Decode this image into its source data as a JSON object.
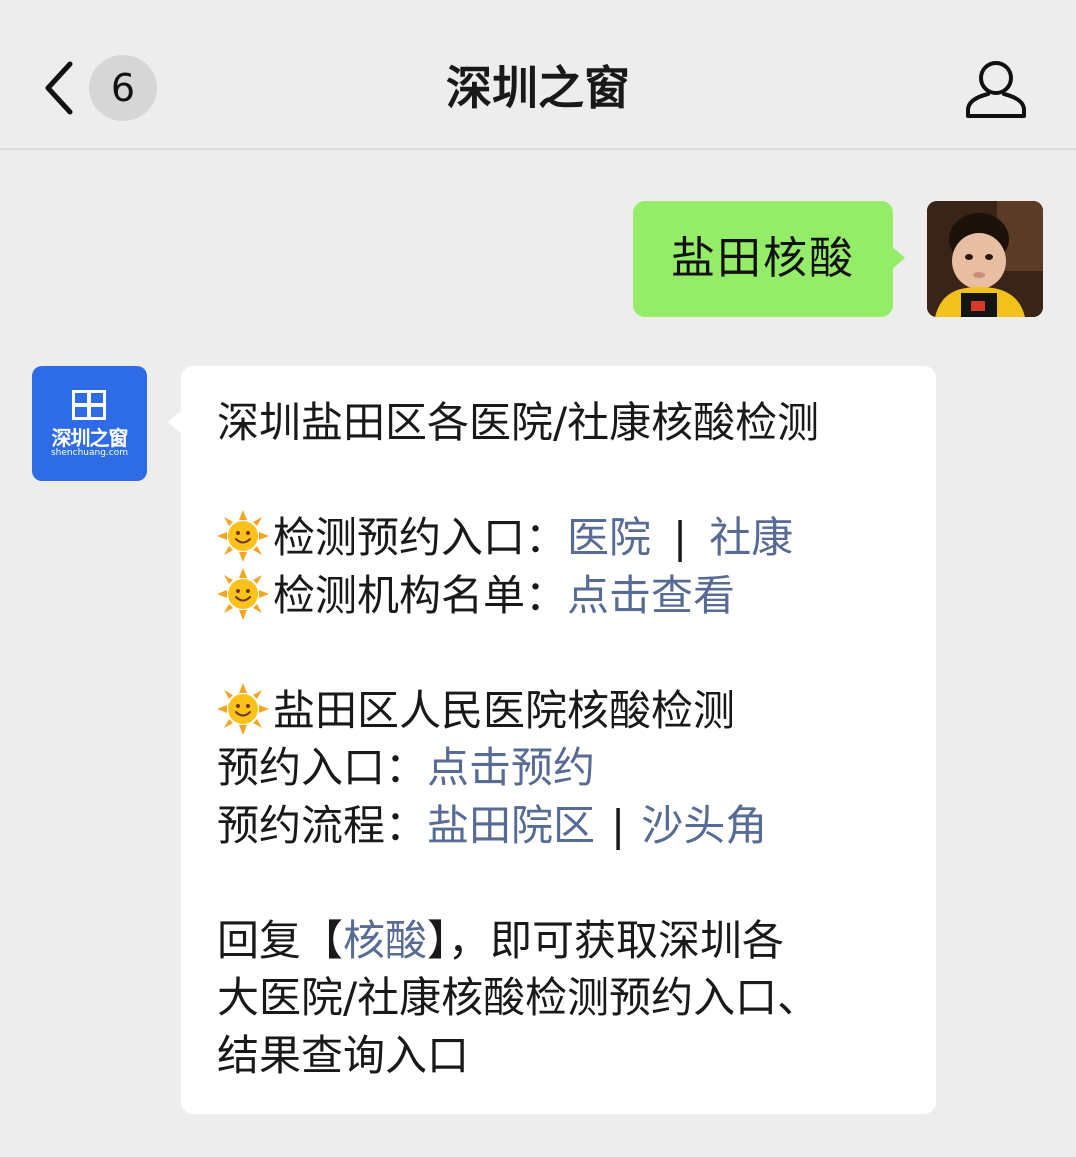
{
  "header": {
    "unread_count": "6",
    "title": "深圳之窗"
  },
  "outgoing": {
    "text": "盐田核酸"
  },
  "bot": {
    "avatar_name": "深圳之窗",
    "avatar_domain": "shenchuang.com"
  },
  "message": {
    "line1": "深圳盐田区各医院/社康核酸检测",
    "appt_label": "检测预约入口：",
    "appt_link1": "医院",
    "appt_sep": "|",
    "appt_link2": "社康",
    "list_label": "检测机构名单：",
    "list_link": "点击查看",
    "hospital_title": "盐田区人民医院核酸检测",
    "entry_label": "预约入口：",
    "entry_link": "点击预约",
    "flow_label": "预约流程：",
    "flow_link1": "盐田院区",
    "flow_sep": "|",
    "flow_link2": "沙头角",
    "reply_pre": "回复【",
    "reply_link": "核酸",
    "reply_post": "】，即可获取深圳各",
    "reply_line2": "大医院/社康核酸检测预约入口、",
    "reply_line3": "结果查询入口"
  }
}
